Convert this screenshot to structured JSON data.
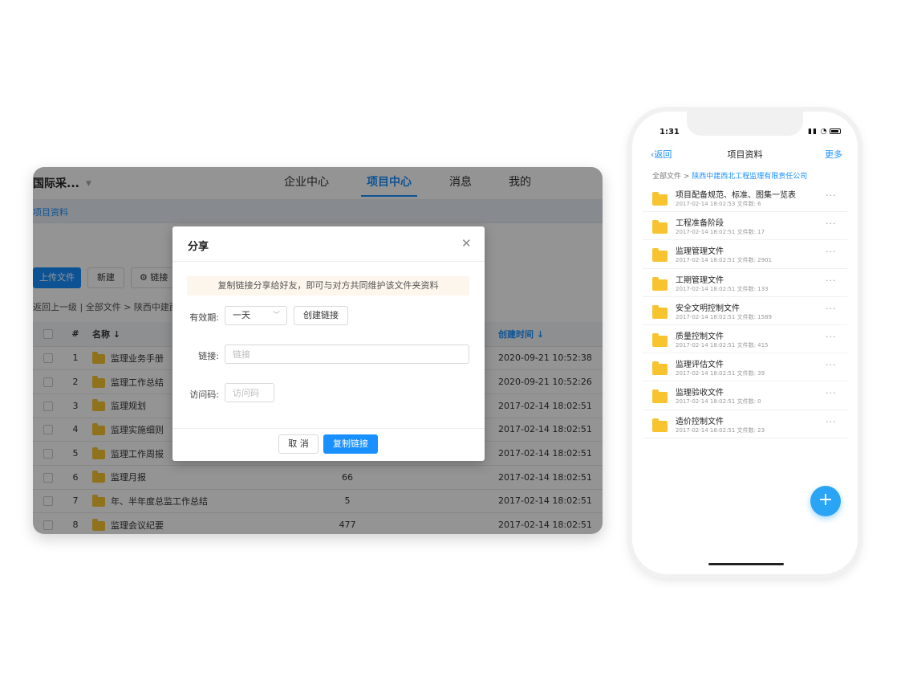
{
  "desktop": {
    "brand": "国际采...",
    "nav": [
      "企业中心",
      "项目中心",
      "消息",
      "我的"
    ],
    "active_nav": "项目中心",
    "crumb": "项目资料",
    "toolbar": {
      "upload": "上传文件",
      "new": "新建",
      "link": "链接"
    },
    "path": "返回上一级 | 全部文件 > 陕西中建西北",
    "table": {
      "headers": [
        "#",
        "名称 ↓",
        "",
        "",
        "",
        "",
        "创建时间 ↓"
      ],
      "rows": [
        {
          "idx": "1",
          "name": "监理业务手册",
          "count": "",
          "time": "2020-09-21 10:52:38"
        },
        {
          "idx": "2",
          "name": "监理工作总结",
          "count": "",
          "time": "2020-09-21 10:52:26"
        },
        {
          "idx": "3",
          "name": "监理规划",
          "count": "",
          "time": "2017-02-14 18:02:51"
        },
        {
          "idx": "4",
          "name": "监理实施细则",
          "count": "",
          "time": "2017-02-14 18:02:51"
        },
        {
          "idx": "5",
          "name": "监理工作周报",
          "count": "",
          "time": "2017-02-14 18:02:51"
        },
        {
          "idx": "6",
          "name": "监理月报",
          "count": "66",
          "time": "2017-02-14 18:02:51"
        },
        {
          "idx": "7",
          "name": "年、半年度总监工作总结",
          "count": "5",
          "time": "2017-02-14 18:02:51"
        },
        {
          "idx": "8",
          "name": "监理会议纪要",
          "count": "477",
          "time": "2017-02-14 18:02:51"
        }
      ]
    }
  },
  "modal": {
    "title": "分享",
    "tip": "复制链接分享给好友，即可与对方共同维护该文件夹资料",
    "validity_label": "有效期:",
    "validity_value": "一天",
    "create_link": "创建链接",
    "link_label": "链接:",
    "link_placeholder": "链接",
    "code_label": "访问码:",
    "code_placeholder": "访问码",
    "cancel": "取 消",
    "copy": "复制链接"
  },
  "phone": {
    "time": "1:31",
    "back": "返回",
    "title": "项目资料",
    "more": "更多",
    "crumb_root": "全部文件",
    "crumb_sep": " > ",
    "crumb_current": "陕西中建西北工程监理有限责任公司",
    "items": [
      {
        "name": "项目配备规范、标准、图集一览表",
        "meta": "2017-02-14 18:02:53  文件数: 6"
      },
      {
        "name": "工程准备阶段",
        "meta": "2017-02-14 18:02:51  文件数: 17"
      },
      {
        "name": "监理管理文件",
        "meta": "2017-02-14 18:02:51  文件数: 2901"
      },
      {
        "name": "工期管理文件",
        "meta": "2017-02-14 18:02:51  文件数: 133"
      },
      {
        "name": "安全文明控制文件",
        "meta": "2017-02-14 18:02:51  文件数: 1589"
      },
      {
        "name": "质量控制文件",
        "meta": "2017-02-14 18:02:51  文件数: 415"
      },
      {
        "name": "监理评估文件",
        "meta": "2017-02-14 18:02:51  文件数: 39"
      },
      {
        "name": "监理验收文件",
        "meta": "2017-02-14 18:02:51  文件数: 0"
      },
      {
        "name": "造价控制文件",
        "meta": "2017-02-14 18:02:51  文件数: 23"
      }
    ],
    "fab": "+"
  },
  "colors": {
    "accent": "#1890ff",
    "folder": "#f7c430",
    "fab": "#2aa4f4",
    "tip_bg": "#fdf6ec"
  }
}
